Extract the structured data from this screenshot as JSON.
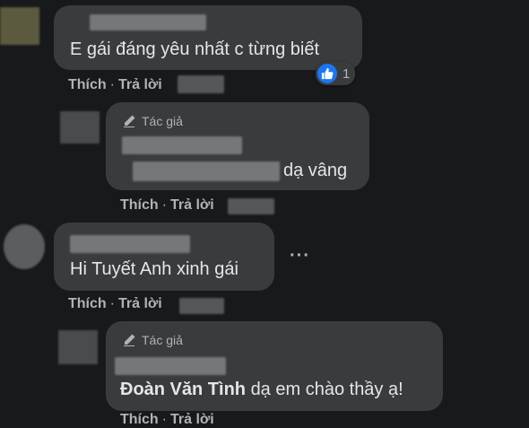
{
  "comments": [
    {
      "text": "E gái đáng yêu nhất c từng biết",
      "actions": {
        "like": "Thích",
        "reply": "Trả lời",
        "separator": "·"
      },
      "reactions": {
        "icon": "like-icon",
        "count": "1"
      }
    },
    {
      "author_badge": "Tác giả",
      "text_suffix": "dạ vâng",
      "actions": {
        "like": "Thích",
        "reply": "Trả lời",
        "separator": "·"
      }
    },
    {
      "text": "Hi Tuyết Anh xinh gái",
      "actions": {
        "like": "Thích",
        "reply": "Trả lời",
        "separator": "·"
      },
      "more_label": "···"
    },
    {
      "author_badge": "Tác giả",
      "mention": "Đoàn Văn Tình",
      "text": "dạ em chào thầy ạ!",
      "actions": {
        "like": "Thích",
        "reply": "Trả lời",
        "separator": "·"
      }
    }
  ],
  "colors": {
    "background": "#18191a",
    "bubble": "#3a3b3c",
    "text": "#e4e6eb",
    "secondary": "#b0b3b8",
    "like_blue": "#1877f2"
  }
}
